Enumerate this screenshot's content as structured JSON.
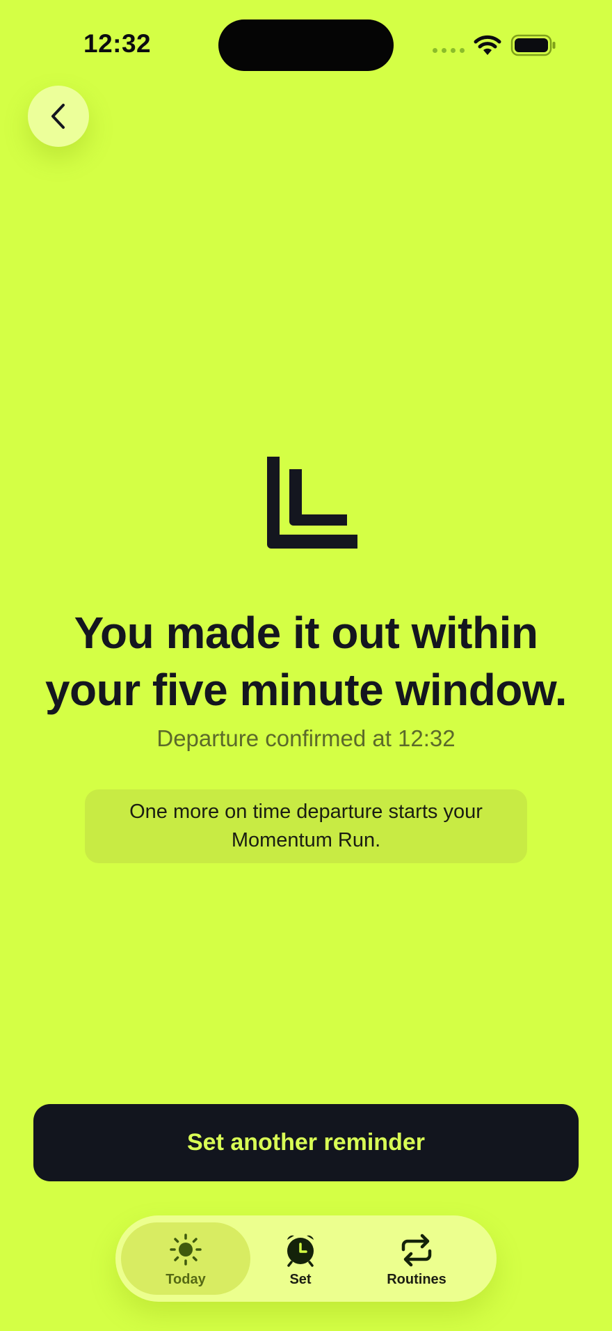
{
  "status_bar": {
    "time": "12:32"
  },
  "navigation": {
    "back_icon": "chevron-left-icon"
  },
  "logo": {
    "icon": "app-logo-mark"
  },
  "confirmation": {
    "headline_line1": "You made it out within",
    "headline_line2": "your five minute window.",
    "subtitle": "Departure confirmed at 12:32",
    "info_line1": "One more on time departure starts your",
    "info_line2": "Momentum Run."
  },
  "actions": {
    "primary_label": "Set another reminder"
  },
  "tab_bar": {
    "items": [
      {
        "label": "Today",
        "icon": "sun-icon",
        "selected": true
      },
      {
        "label": "Set",
        "icon": "alarm-clock-icon",
        "selected": false
      },
      {
        "label": "Routines",
        "icon": "repeat-icon",
        "selected": false
      }
    ]
  },
  "colors": {
    "background": "#d4ff45",
    "ink": "#14161f",
    "button_background": "#12151e",
    "button_text": "#d9ff55",
    "card_background": "#c8eb44",
    "tab_bar_background": "#ecff8e",
    "tab_selected_background": "#d8ec62"
  }
}
